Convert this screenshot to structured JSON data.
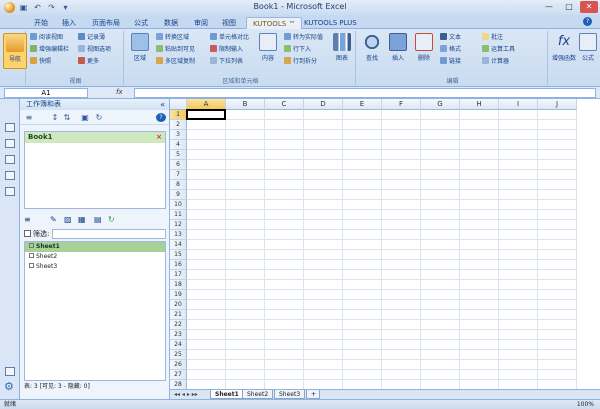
{
  "window": {
    "title": "Book1 - Microsoft Excel"
  },
  "tabs": [
    {
      "label": "开始"
    },
    {
      "label": "插入"
    },
    {
      "label": "页面布局"
    },
    {
      "label": "公式"
    },
    {
      "label": "数据"
    },
    {
      "label": "审阅"
    },
    {
      "label": "视图"
    },
    {
      "label": "KUTOOLS ™"
    },
    {
      "label": "KUTOOLS PLUS"
    }
  ],
  "ribbon": {
    "nav_label": "导航",
    "view_group_label": "视图",
    "range_group_label": "区域和单元格",
    "edit_group_label": "编辑",
    "view_items": [
      "阅读视图",
      "增强编辑栏",
      "快照",
      "记录薄",
      "视图选项",
      "更多"
    ],
    "range_big": [
      "区域",
      "内容",
      "图表",
      "查找",
      "插入",
      "删除",
      "文本",
      "格式",
      "链接",
      "增强函数",
      "公式"
    ],
    "range_small": [
      "转换区域",
      "粘贴到可见",
      "多区域复制",
      "单元格对比",
      "限制输入",
      "下拉列表",
      "转为实际值",
      "行下入",
      "行到拆分"
    ],
    "edit_small": [
      "批注",
      "运算工具",
      "计算器"
    ]
  },
  "formula": {
    "namebox": "A1",
    "fx": "fx",
    "value": ""
  },
  "pane": {
    "title": "工作簿和表",
    "workbook": "Book1",
    "filter_label": "筛选:",
    "sheets": [
      "Sheet1",
      "Sheet2",
      "Sheet3"
    ],
    "status": "表: 3 [可见: 3 - 隐藏: 0]"
  },
  "grid": {
    "columns": [
      "A",
      "B",
      "C",
      "D",
      "E",
      "F",
      "G",
      "H",
      "I",
      "J"
    ],
    "rows": [
      "1",
      "2",
      "3",
      "4",
      "5",
      "6",
      "7",
      "8",
      "9",
      "10",
      "11",
      "12",
      "13",
      "14",
      "15",
      "16",
      "17",
      "18",
      "19",
      "20",
      "21",
      "22",
      "23",
      "24",
      "25",
      "26",
      "27",
      "28"
    ]
  },
  "sheettabs": [
    "Sheet1",
    "Sheet2",
    "Sheet3"
  ],
  "status": {
    "ready": "就绪",
    "zoom": "100%"
  }
}
